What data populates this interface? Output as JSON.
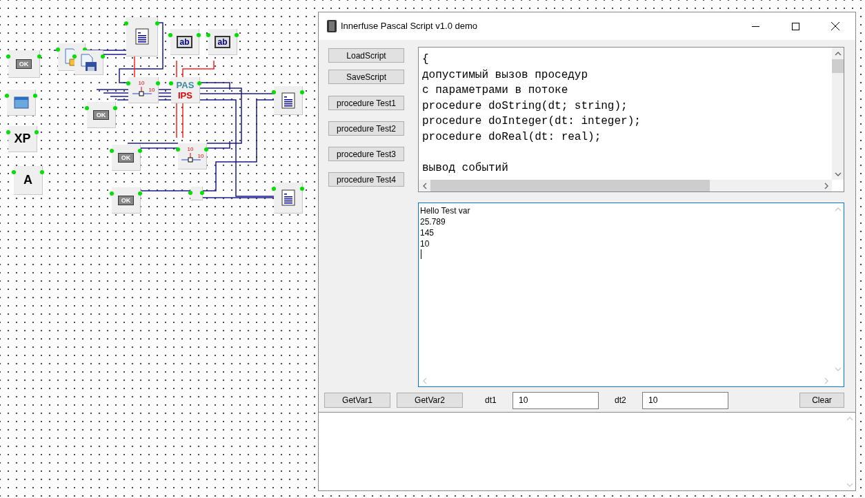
{
  "canvas": {
    "nodes": [
      {
        "kind": "button",
        "label": "OK"
      },
      {
        "kind": "open"
      },
      {
        "kind": "save"
      },
      {
        "kind": "memo"
      },
      {
        "kind": "edit",
        "label": "ab"
      },
      {
        "kind": "edit",
        "label": "ab"
      },
      {
        "kind": "axis",
        "labels": [
          "10",
          "10"
        ]
      },
      {
        "kind": "engine",
        "labels": [
          "PAS",
          "IPS"
        ]
      },
      {
        "kind": "memo"
      },
      {
        "kind": "form"
      },
      {
        "kind": "text",
        "label": "XP"
      },
      {
        "kind": "text",
        "label": "A"
      },
      {
        "kind": "button",
        "label": "OK"
      },
      {
        "kind": "button",
        "label": "OK"
      },
      {
        "kind": "axis",
        "labels": [
          "10",
          "10"
        ]
      },
      {
        "kind": "button",
        "label": "OK"
      },
      {
        "kind": "small"
      },
      {
        "kind": "memo"
      }
    ]
  },
  "window": {
    "title": "Innerfuse Pascal Script v1.0 demo",
    "side_buttons": [
      "LoadScript",
      "SaveScript",
      "procedure Test1",
      "procedure Test2",
      "procedure Test3",
      "procedure Test4"
    ],
    "code_editor": {
      "paragraphs": [
        [
          "{",
          "допустимый вызов проседур",
          "с параметрами в потоке",
          "procedure doString(dt; string);",
          "procedure doInteger(dt: integer);",
          "procedure doReal(dt: real);"
        ],
        [
          "вывод событий"
        ]
      ]
    },
    "output": {
      "lines": [
        "Hello Test var",
        "25.789",
        "145",
        "10"
      ]
    },
    "bottom_bar": {
      "buttons": [
        "GetVar1",
        "GetVar2"
      ],
      "fields": [
        {
          "label": "dt1",
          "value": "10"
        },
        {
          "label": "dt2",
          "value": "10"
        }
      ],
      "clear_button": "Clear"
    }
  }
}
